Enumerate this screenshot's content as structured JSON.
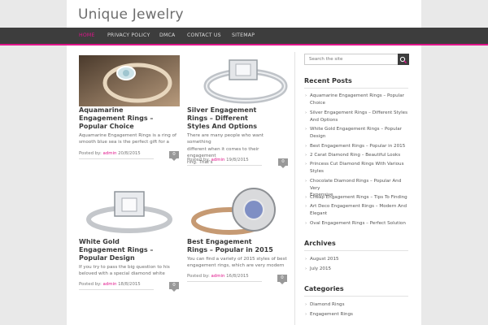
{
  "site": {
    "title": "Unique Jewelry"
  },
  "nav": {
    "items": [
      "HOME",
      "PRIVACY POLICY",
      "DMCA",
      "CONTACT US",
      "SITEMAP"
    ]
  },
  "posts": [
    {
      "title_lines": [
        "Aquamarine",
        "Engagement Rings –",
        "Popular Choice"
      ],
      "excerpt_lines": [
        "Aquamarine Engagement Rings is a ring of",
        "smooth blue sea is the perfect gift for a"
      ],
      "meta_prefix": "Posted by:",
      "author": "admin",
      "date": "20/8/2015",
      "comments": "0"
    },
    {
      "title_lines": [
        "Silver Engagement",
        "Rings – Different",
        "Styles And Options"
      ],
      "excerpt_lines": [
        "There are many people who want something",
        "different when it comes to their engagement",
        "ring. That's"
      ],
      "meta_prefix": "Posted by:",
      "author": "admin",
      "date": "19/8/2015",
      "comments": "0"
    },
    {
      "title_lines": [
        "White Gold",
        "Engagement Rings –",
        "Popular Design"
      ],
      "excerpt_lines": [
        "If you try to pass the big question to his",
        "beloved with a special diamond white"
      ],
      "meta_prefix": "Posted by:",
      "author": "admin",
      "date": "18/8/2015",
      "comments": "0"
    },
    {
      "title_lines": [
        "Best Engagement",
        "Rings – Popular in 2015"
      ],
      "excerpt_lines": [
        "You can find a variety of 2015 styles of best",
        "engagement rings, which are very modern"
      ],
      "meta_prefix": "Posted by:",
      "author": "admin",
      "date": "16/8/2015",
      "comments": "0"
    }
  ],
  "sidebar": {
    "search_placeholder": "Search the site",
    "recent_title": "Recent Posts",
    "recent": [
      [
        "Aquamarine Engagement Rings – Popular",
        "Choice"
      ],
      [
        "Silver Engagement Rings – Different Styles",
        "And Options"
      ],
      [
        "White Gold Engagement Rings – Popular",
        "Design"
      ],
      [
        "Best Engagement Rings – Popular in 2015"
      ],
      [
        "2 Carat Diamond Ring – Beautiful Looks"
      ],
      [
        "Princess Cut Diamond Rings With Various",
        "Styles"
      ],
      [
        "Chocolate Diamond Rings – Popular And Very",
        "Expensive"
      ],
      [
        "Cheap Engagement Rings – Tips To Finding"
      ],
      [
        "Art Deco Engagement Rings – Modern And",
        "Elegant"
      ],
      [
        "Oval Engagement Rings – Perfect Solution"
      ]
    ],
    "archives_title": "Archives",
    "archives": [
      "August 2015",
      "July 2015"
    ],
    "categories_title": "Categories",
    "categories": [
      "Diamond Rings",
      "Engagement Rings"
    ]
  },
  "colors": {
    "accent": "#e0158b",
    "nav_bg": "#3d3d3d"
  }
}
